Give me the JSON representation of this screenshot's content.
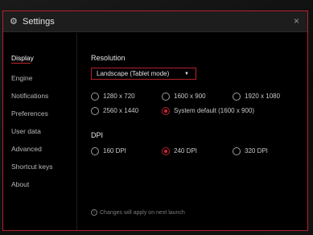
{
  "window": {
    "title": "Settings",
    "icon": "gear-icon",
    "close_glyph": "×"
  },
  "colors": {
    "accent": "#c0262f",
    "background": "#000000",
    "titlebar": "#1d1d1d"
  },
  "sidebar": {
    "items": [
      {
        "label": "Display",
        "active": true
      },
      {
        "label": "Engine"
      },
      {
        "label": "Notifications"
      },
      {
        "label": "Preferences"
      },
      {
        "label": "User data"
      },
      {
        "label": "Advanced"
      },
      {
        "label": "Shortcut keys"
      },
      {
        "label": "About"
      }
    ]
  },
  "resolution": {
    "heading": "Resolution",
    "mode_value": "Landscape (Tablet mode)",
    "options": [
      {
        "label": "1280 x 720",
        "checked": false
      },
      {
        "label": "1600 x 900",
        "checked": false
      },
      {
        "label": "1920 x 1080",
        "checked": false
      },
      {
        "label": "2560 x 1440",
        "checked": false
      },
      {
        "label": "System default (1600 x 900)",
        "checked": true
      }
    ]
  },
  "dpi": {
    "heading": "DPI",
    "options": [
      {
        "label": "160 DPI",
        "checked": false
      },
      {
        "label": "240 DPI",
        "checked": true
      },
      {
        "label": "320 DPI",
        "checked": false
      }
    ]
  },
  "footer": {
    "note": "Changes will apply on next launch",
    "icon": "info-icon"
  }
}
